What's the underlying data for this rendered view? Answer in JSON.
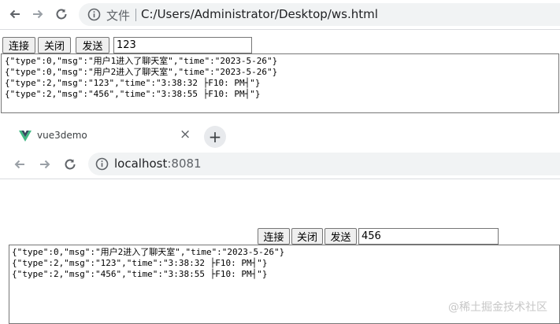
{
  "window1": {
    "address": {
      "label": "文件",
      "url": "C:/Users/Administrator/Desktop/ws.html"
    },
    "controls": {
      "connect": "连接",
      "close": "关闭",
      "send": "发送",
      "input_value": "123"
    },
    "messages": [
      "{\"type\":0,\"msg\":\"用户1进入了聊天室\",\"time\":\"2023-5-26\"}",
      "{\"type\":0,\"msg\":\"用户2进入了聊天室\",\"time\":\"2023-5-26\"}",
      "{\"type\":2,\"msg\":\"123\",\"time\":\"3:38:32 ├F10: PM┤\"}",
      "{\"type\":2,\"msg\":\"456\",\"time\":\"3:38:55 ├F10: PM┤\"}"
    ]
  },
  "window2": {
    "tab": {
      "title": "vue3demo",
      "close_glyph": "×",
      "new_tab_glyph": "+"
    },
    "address": {
      "host": "localhost",
      "port": ":8081"
    },
    "controls": {
      "connect": "连接",
      "close": "关闭",
      "send": "发送",
      "input_value": "456"
    },
    "messages": [
      "{\"type\":0,\"msg\":\"用户2进入了聊天室\",\"time\":\"2023-5-26\"}",
      "{\"type\":2,\"msg\":\"123\",\"time\":\"3:38:32 ├F10: PM┤\"}",
      "{\"type\":2,\"msg\":\"456\",\"time\":\"3:38:55 ├F10: PM┤\"}"
    ]
  },
  "watermark": "@稀土掘金技术社区",
  "icons": {
    "back": "back-arrow-icon",
    "forward": "forward-arrow-icon",
    "reload": "reload-icon",
    "info": "info-icon",
    "vue_logo": "vue-logo-icon"
  },
  "colors": {
    "vue_green": "#41b883",
    "vue_dark": "#35495e",
    "omnibox_bg": "#f1f3f4"
  }
}
